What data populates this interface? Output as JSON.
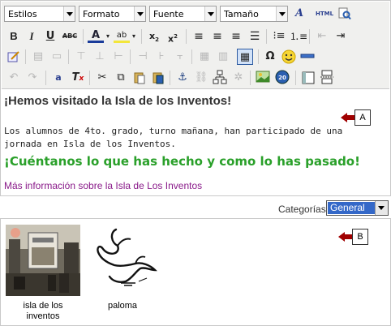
{
  "toolbar": {
    "combos": {
      "styles": "Estilos",
      "format": "Formato",
      "font": "Fuente",
      "size": "Tamaño"
    },
    "buttons": {
      "html": "HTML"
    }
  },
  "content": {
    "heading1": "¡Hemos visitado la Isla de los Inventos!",
    "paragraph": "Los alumnos de 4to. grado, turno mañana, han participado de una jornada en Isla de los Inventos.",
    "heading2": "¡Cuéntanos lo que has hecho y como lo has pasado!",
    "link_text": "Más información sobre la Isla de Los Inventos"
  },
  "markers": {
    "a": "A",
    "b": "B"
  },
  "categories": {
    "label": "Categorías",
    "selected": "General"
  },
  "gallery": {
    "items": [
      {
        "caption": "isla de los inventos"
      },
      {
        "caption": "paloma"
      }
    ]
  },
  "colors": {
    "heading2": "#2aa02a",
    "link": "#8a1b8a",
    "marker": "#a00000",
    "select_highlight": "#3468c8"
  }
}
